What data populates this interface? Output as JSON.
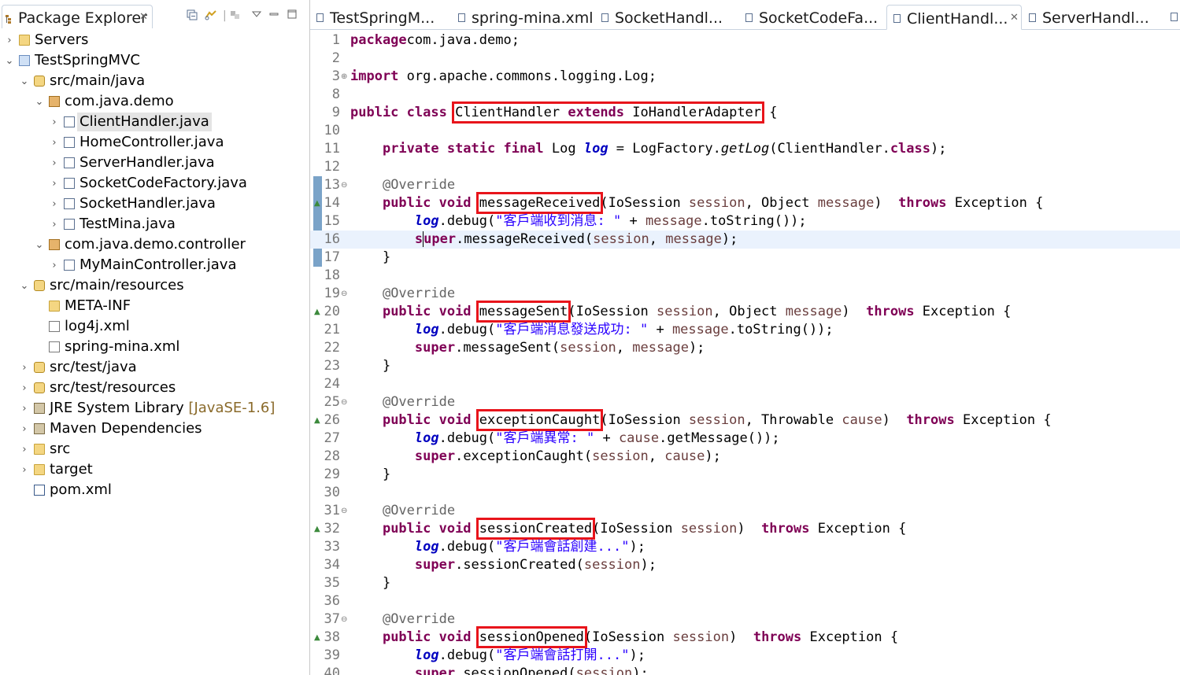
{
  "explorer": {
    "title": "Package Explorer",
    "tree": [
      {
        "label": "Servers",
        "icon": "folder-icon",
        "arrow": "›"
      },
      {
        "label": "TestSpringMVC",
        "icon": "project-icon",
        "arrow": "⌄"
      },
      {
        "label": "src/main/java",
        "icon": "source-folder-icon",
        "arrow": "⌄"
      },
      {
        "label": "com.java.demo",
        "icon": "package-icon",
        "arrow": "⌄"
      },
      {
        "label": "ClientHandler.java",
        "icon": "java-file-icon",
        "arrow": "›"
      },
      {
        "label": "HomeController.java",
        "icon": "java-file-icon",
        "arrow": "›"
      },
      {
        "label": "ServerHandler.java",
        "icon": "java-file-icon",
        "arrow": "›"
      },
      {
        "label": "SocketCodeFactory.java",
        "icon": "java-file-icon",
        "arrow": "›"
      },
      {
        "label": "SocketHandler.java",
        "icon": "java-file-icon",
        "arrow": "›"
      },
      {
        "label": "TestMina.java",
        "icon": "java-file-icon",
        "arrow": "›"
      },
      {
        "label": "com.java.demo.controller",
        "icon": "package-icon",
        "arrow": "⌄"
      },
      {
        "label": "MyMainController.java",
        "icon": "java-file-icon",
        "arrow": "›"
      },
      {
        "label": "src/main/resources",
        "icon": "source-folder-icon",
        "arrow": "⌄"
      },
      {
        "label": "META-INF",
        "icon": "folder-icon",
        "arrow": ""
      },
      {
        "label": "log4j.xml",
        "icon": "xml-file-icon",
        "arrow": ""
      },
      {
        "label": "spring-mina.xml",
        "icon": "xml-file-icon",
        "arrow": ""
      },
      {
        "label": "src/test/java",
        "icon": "source-folder-icon",
        "arrow": "›"
      },
      {
        "label": "src/test/resources",
        "icon": "source-folder-icon",
        "arrow": "›"
      },
      {
        "label": "JRE System Library",
        "suffix": " [JavaSE-1.6]",
        "icon": "library-icon",
        "arrow": "›"
      },
      {
        "label": "Maven Dependencies",
        "icon": "library-icon",
        "arrow": "›"
      },
      {
        "label": "src",
        "icon": "folder-icon",
        "arrow": "›"
      },
      {
        "label": "target",
        "icon": "folder-icon",
        "arrow": "›"
      },
      {
        "label": "pom.xml",
        "icon": "maven-file-icon",
        "arrow": ""
      }
    ]
  },
  "editor": {
    "tabs": [
      {
        "label": "TestSpringM...",
        "active": false
      },
      {
        "label": "spring-mina.xml",
        "active": false
      },
      {
        "label": "SocketHandl...",
        "active": false
      },
      {
        "label": "SocketCodeFa...",
        "active": false
      },
      {
        "label": "ClientHandl...",
        "active": true
      },
      {
        "label": "ServerHandl...",
        "active": false
      }
    ],
    "lines": [
      {
        "no": "1",
        "segs": [
          [
            "kw",
            "package"
          ],
          [
            "",
            "com.java.demo;"
          ]
        ]
      },
      {
        "no": "2",
        "segs": []
      },
      {
        "no": "3",
        "fold": "⊕",
        "segs": [
          [
            "kw",
            "import"
          ],
          [
            "",
            " org.apache.commons.logging.Log;"
          ]
        ]
      },
      {
        "no": "8",
        "segs": []
      },
      {
        "no": "9",
        "segs": [
          [
            "kw",
            "public class"
          ],
          [
            "",
            " "
          ],
          [
            "hl",
            "ClientHandler "
          ],
          [
            "hlkw",
            "extends"
          ],
          [
            "hl",
            " IoHandlerAdapter"
          ],
          [
            "",
            " {"
          ]
        ]
      },
      {
        "no": "10",
        "segs": []
      },
      {
        "no": "11",
        "segs": [
          [
            "",
            "    "
          ],
          [
            "kw",
            "private static final"
          ],
          [
            "",
            " Log "
          ],
          [
            "field",
            "log"
          ],
          [
            "",
            " = LogFactory."
          ],
          [
            "sm",
            "getLog"
          ],
          [
            "",
            "(ClientHandler."
          ],
          [
            "kw",
            "class"
          ],
          [
            "",
            ");"
          ]
        ]
      },
      {
        "no": "12",
        "segs": []
      },
      {
        "no": "13",
        "fold": "⊖",
        "segs": [
          [
            "",
            "    "
          ],
          [
            "ann",
            "@Override"
          ]
        ]
      },
      {
        "no": "14",
        "ovr": "▲",
        "segs": [
          [
            "",
            "    "
          ],
          [
            "kw",
            "public void"
          ],
          [
            "",
            " "
          ],
          [
            "hl",
            "messageReceived"
          ],
          [
            "",
            "(IoSession "
          ],
          [
            "param",
            "session"
          ],
          [
            "",
            ", Object "
          ],
          [
            "param",
            "message"
          ],
          [
            "",
            ")  "
          ],
          [
            "kw",
            "throws"
          ],
          [
            "",
            " Exception {"
          ]
        ]
      },
      {
        "no": "15",
        "segs": [
          [
            "",
            "        "
          ],
          [
            "field",
            "log"
          ],
          [
            "",
            ".debug("
          ],
          [
            "str",
            "\"客戶端收到消息: \""
          ],
          [
            "",
            " + "
          ],
          [
            "param",
            "message"
          ],
          [
            "",
            ".toString());"
          ]
        ]
      },
      {
        "no": "16",
        "current": true,
        "segs": [
          [
            "",
            "        "
          ],
          [
            "kw",
            "s"
          ],
          [
            "cursorkw",
            "uper"
          ],
          [
            "",
            ".messageReceived("
          ],
          [
            "param",
            "session"
          ],
          [
            "",
            ", "
          ],
          [
            "param",
            "message"
          ],
          [
            "",
            ");"
          ]
        ]
      },
      {
        "no": "17",
        "segs": [
          [
            "",
            "    }"
          ]
        ]
      },
      {
        "no": "18",
        "segs": []
      },
      {
        "no": "19",
        "fold": "⊖",
        "segs": [
          [
            "",
            "    "
          ],
          [
            "ann",
            "@Override"
          ]
        ]
      },
      {
        "no": "20",
        "ovr": "▲",
        "segs": [
          [
            "",
            "    "
          ],
          [
            "kw",
            "public void"
          ],
          [
            "",
            " "
          ],
          [
            "hl",
            "messageSent"
          ],
          [
            "",
            "(IoSession "
          ],
          [
            "param",
            "session"
          ],
          [
            "",
            ", Object "
          ],
          [
            "param",
            "message"
          ],
          [
            "",
            ")  "
          ],
          [
            "kw",
            "throws"
          ],
          [
            "",
            " Exception {"
          ]
        ]
      },
      {
        "no": "21",
        "segs": [
          [
            "",
            "        "
          ],
          [
            "field",
            "log"
          ],
          [
            "",
            ".debug("
          ],
          [
            "str",
            "\"客戶端消息發送成功: \""
          ],
          [
            "",
            " + "
          ],
          [
            "param",
            "message"
          ],
          [
            "",
            ".toString());"
          ]
        ]
      },
      {
        "no": "22",
        "segs": [
          [
            "",
            "        "
          ],
          [
            "kw",
            "super"
          ],
          [
            "",
            ".messageSent("
          ],
          [
            "param",
            "session"
          ],
          [
            "",
            ", "
          ],
          [
            "param",
            "message"
          ],
          [
            "",
            ");"
          ]
        ]
      },
      {
        "no": "23",
        "segs": [
          [
            "",
            "    }"
          ]
        ]
      },
      {
        "no": "24",
        "segs": []
      },
      {
        "no": "25",
        "fold": "⊖",
        "segs": [
          [
            "",
            "    "
          ],
          [
            "ann",
            "@Override"
          ]
        ]
      },
      {
        "no": "26",
        "ovr": "▲",
        "segs": [
          [
            "",
            "    "
          ],
          [
            "kw",
            "public void"
          ],
          [
            "",
            " "
          ],
          [
            "hl",
            "exceptionCaught"
          ],
          [
            "",
            "(IoSession "
          ],
          [
            "param",
            "session"
          ],
          [
            "",
            ", Throwable "
          ],
          [
            "param",
            "cause"
          ],
          [
            "",
            ")  "
          ],
          [
            "kw",
            "throws"
          ],
          [
            "",
            " Exception {"
          ]
        ]
      },
      {
        "no": "27",
        "segs": [
          [
            "",
            "        "
          ],
          [
            "field",
            "log"
          ],
          [
            "",
            ".debug("
          ],
          [
            "str",
            "\"客戶端異常: \""
          ],
          [
            "",
            " + "
          ],
          [
            "param",
            "cause"
          ],
          [
            "",
            ".getMessage());"
          ]
        ]
      },
      {
        "no": "28",
        "segs": [
          [
            "",
            "        "
          ],
          [
            "kw",
            "super"
          ],
          [
            "",
            ".exceptionCaught("
          ],
          [
            "param",
            "session"
          ],
          [
            "",
            ", "
          ],
          [
            "param",
            "cause"
          ],
          [
            "",
            ");"
          ]
        ]
      },
      {
        "no": "29",
        "segs": [
          [
            "",
            "    }"
          ]
        ]
      },
      {
        "no": "30",
        "segs": []
      },
      {
        "no": "31",
        "fold": "⊖",
        "segs": [
          [
            "",
            "    "
          ],
          [
            "ann",
            "@Override"
          ]
        ]
      },
      {
        "no": "32",
        "ovr": "▲",
        "segs": [
          [
            "",
            "    "
          ],
          [
            "kw",
            "public void"
          ],
          [
            "",
            " "
          ],
          [
            "hl",
            "sessionCreated"
          ],
          [
            "",
            "(IoSession "
          ],
          [
            "param",
            "session"
          ],
          [
            "",
            ")  "
          ],
          [
            "kw",
            "throws"
          ],
          [
            "",
            " Exception {"
          ]
        ]
      },
      {
        "no": "33",
        "segs": [
          [
            "",
            "        "
          ],
          [
            "field",
            "log"
          ],
          [
            "",
            ".debug("
          ],
          [
            "str",
            "\"客戶端會話創建...\""
          ],
          [
            "",
            ");"
          ]
        ]
      },
      {
        "no": "34",
        "segs": [
          [
            "",
            "        "
          ],
          [
            "kw",
            "super"
          ],
          [
            "",
            ".sessionCreated("
          ],
          [
            "param",
            "session"
          ],
          [
            "",
            ");"
          ]
        ]
      },
      {
        "no": "35",
        "segs": [
          [
            "",
            "    }"
          ]
        ]
      },
      {
        "no": "36",
        "segs": []
      },
      {
        "no": "37",
        "fold": "⊖",
        "segs": [
          [
            "",
            "    "
          ],
          [
            "ann",
            "@Override"
          ]
        ]
      },
      {
        "no": "38",
        "ovr": "▲",
        "segs": [
          [
            "",
            "    "
          ],
          [
            "kw",
            "public void"
          ],
          [
            "",
            " "
          ],
          [
            "hl",
            "sessionOpened"
          ],
          [
            "",
            "(IoSession "
          ],
          [
            "param",
            "session"
          ],
          [
            "",
            ")  "
          ],
          [
            "kw",
            "throws"
          ],
          [
            "",
            " Exception {"
          ]
        ]
      },
      {
        "no": "39",
        "segs": [
          [
            "",
            "        "
          ],
          [
            "field",
            "log"
          ],
          [
            "",
            ".debug("
          ],
          [
            "str",
            "\"客戶端會話打開...\""
          ],
          [
            "",
            ");"
          ]
        ]
      },
      {
        "no": "40",
        "segs": [
          [
            "",
            "        "
          ],
          [
            "kw",
            "super"
          ],
          [
            "",
            ".sessionOpened("
          ],
          [
            "param",
            "session"
          ],
          [
            "",
            ");"
          ]
        ]
      }
    ]
  }
}
